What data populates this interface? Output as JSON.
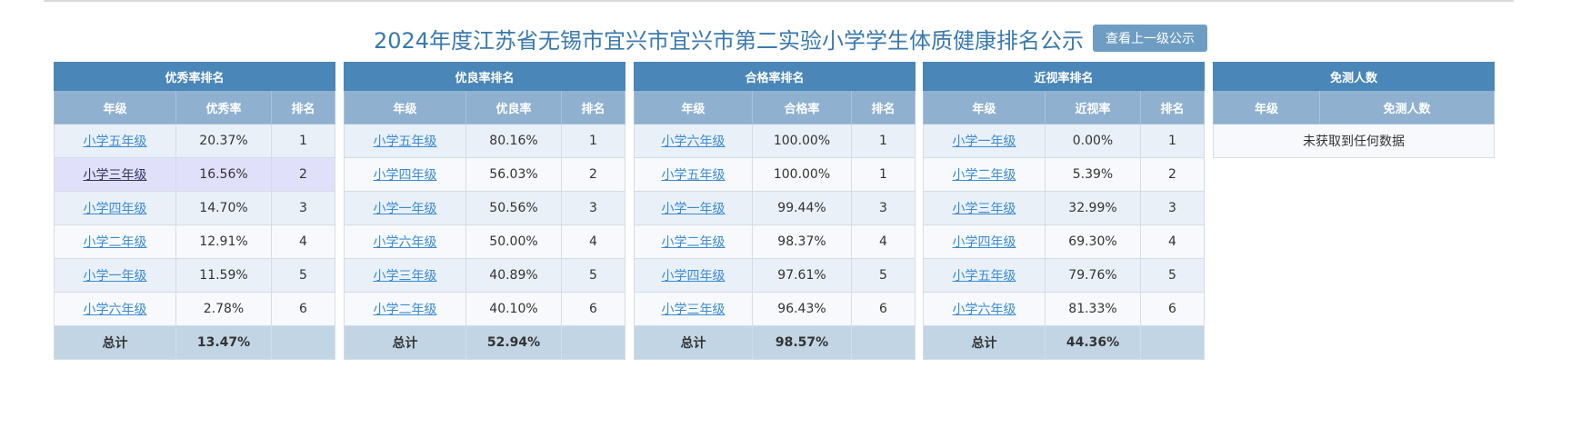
{
  "header": {
    "title": "2024年度江苏省无锡市宜兴市宜兴市第二实验小学学生体质健康排名公示",
    "up_button": "查看上一级公示"
  },
  "panels": [
    {
      "title": "优秀率排名",
      "columns": [
        "年级",
        "优秀率",
        "排名"
      ],
      "rows": [
        {
          "grade": "小学五年级",
          "rate": "20.37%",
          "rank": "1"
        },
        {
          "grade": "小学三年级",
          "rate": "16.56%",
          "rank": "2"
        },
        {
          "grade": "小学四年级",
          "rate": "14.70%",
          "rank": "3"
        },
        {
          "grade": "小学二年级",
          "rate": "12.91%",
          "rank": "4"
        },
        {
          "grade": "小学一年级",
          "rate": "11.59%",
          "rank": "5"
        },
        {
          "grade": "小学六年级",
          "rate": "2.78%",
          "rank": "6"
        }
      ],
      "total_label": "总计",
      "total_value": "13.47%"
    },
    {
      "title": "优良率排名",
      "columns": [
        "年级",
        "优良率",
        "排名"
      ],
      "rows": [
        {
          "grade": "小学五年级",
          "rate": "80.16%",
          "rank": "1"
        },
        {
          "grade": "小学四年级",
          "rate": "56.03%",
          "rank": "2"
        },
        {
          "grade": "小学一年级",
          "rate": "50.56%",
          "rank": "3"
        },
        {
          "grade": "小学六年级",
          "rate": "50.00%",
          "rank": "4"
        },
        {
          "grade": "小学三年级",
          "rate": "40.89%",
          "rank": "5"
        },
        {
          "grade": "小学二年级",
          "rate": "40.10%",
          "rank": "6"
        }
      ],
      "total_label": "总计",
      "total_value": "52.94%"
    },
    {
      "title": "合格率排名",
      "columns": [
        "年级",
        "合格率",
        "排名"
      ],
      "rows": [
        {
          "grade": "小学六年级",
          "rate": "100.00%",
          "rank": "1"
        },
        {
          "grade": "小学五年级",
          "rate": "100.00%",
          "rank": "1"
        },
        {
          "grade": "小学一年级",
          "rate": "99.44%",
          "rank": "3"
        },
        {
          "grade": "小学二年级",
          "rate": "98.37%",
          "rank": "4"
        },
        {
          "grade": "小学四年级",
          "rate": "97.61%",
          "rank": "5"
        },
        {
          "grade": "小学三年级",
          "rate": "96.43%",
          "rank": "6"
        }
      ],
      "total_label": "总计",
      "total_value": "98.57%"
    },
    {
      "title": "近视率排名",
      "columns": [
        "年级",
        "近视率",
        "排名"
      ],
      "rows": [
        {
          "grade": "小学一年级",
          "rate": "0.00%",
          "rank": "1"
        },
        {
          "grade": "小学二年级",
          "rate": "5.39%",
          "rank": "2"
        },
        {
          "grade": "小学三年级",
          "rate": "32.99%",
          "rank": "3"
        },
        {
          "grade": "小学四年级",
          "rate": "69.30%",
          "rank": "4"
        },
        {
          "grade": "小学五年级",
          "rate": "79.76%",
          "rank": "5"
        },
        {
          "grade": "小学六年级",
          "rate": "81.33%",
          "rank": "6"
        }
      ],
      "total_label": "总计",
      "total_value": "44.36%"
    }
  ],
  "exempt": {
    "title": "免测人数",
    "columns": [
      "年级",
      "免测人数"
    ],
    "empty_message": "未获取到任何数据"
  },
  "colors": {
    "title_blue": "#3a79ad",
    "header_bar": "#4a86b7",
    "subheader": "#8fb1cf",
    "link": "#3a8bd0",
    "highlight_row": "#e1e0fb",
    "total_row": "#c2d5e4"
  }
}
